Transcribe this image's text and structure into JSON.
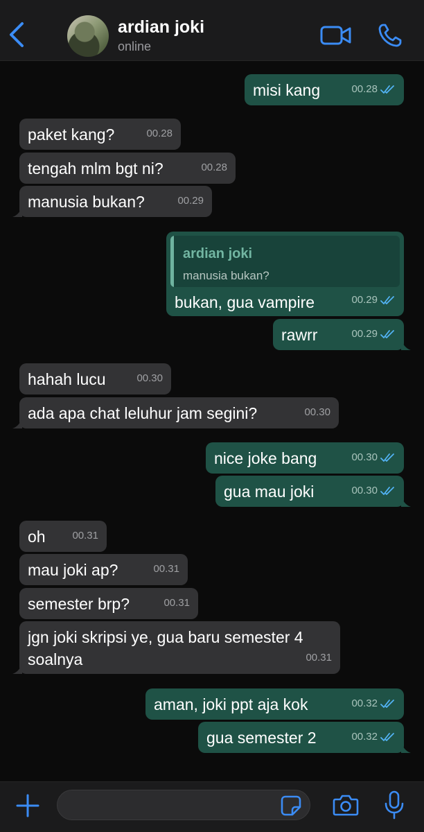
{
  "header": {
    "contact_name": "ardian joki",
    "status": "online"
  },
  "icons": {
    "back": "chevron-left-icon",
    "video": "video-camera-icon",
    "call": "phone-icon",
    "plus": "plus-icon",
    "sticker": "sticker-icon",
    "camera": "camera-icon",
    "mic": "microphone-icon",
    "read_receipt": "double-check-icon"
  },
  "colors": {
    "accent_blue": "#3b8cf5",
    "outgoing_bubble": "#1f5246",
    "incoming_bubble": "#333335",
    "read_tick": "#53b3f5"
  },
  "messages": [
    {
      "dir": "out",
      "text": "misi kang",
      "time": "00.28"
    },
    {
      "dir": "in",
      "text": "paket kang?",
      "time": "00.28"
    },
    {
      "dir": "in",
      "text": "tengah mlm bgt ni?",
      "time": "00.28"
    },
    {
      "dir": "in",
      "text": "manusia bukan?",
      "time": "00.29"
    },
    {
      "dir": "out",
      "text": "bukan, gua vampire",
      "time": "00.29",
      "reply": {
        "name": "ardian joki",
        "text": "manusia bukan?"
      }
    },
    {
      "dir": "out",
      "text": "rawrr",
      "time": "00.29"
    },
    {
      "dir": "in",
      "text": "hahah lucu",
      "time": "00.30"
    },
    {
      "dir": "in",
      "text": "ada apa chat leluhur jam segini?",
      "time": "00.30"
    },
    {
      "dir": "out",
      "text": "nice joke bang",
      "time": "00.30"
    },
    {
      "dir": "out",
      "text": "gua mau joki",
      "time": "00.30"
    },
    {
      "dir": "in",
      "text": "oh",
      "time": "00.31"
    },
    {
      "dir": "in",
      "text": "mau joki ap?",
      "time": "00.31"
    },
    {
      "dir": "in",
      "text": "semester brp?",
      "time": "00.31"
    },
    {
      "dir": "in",
      "text_line1": "jgn joki skripsi ye, gua baru semester 4",
      "text_line2": "soalnya",
      "time": "00.31"
    },
    {
      "dir": "out",
      "text": "aman, joki ppt aja kok",
      "time": "00.32"
    },
    {
      "dir": "out",
      "text": "gua semester 2",
      "time": "00.32"
    }
  ],
  "composer": {
    "value": "",
    "placeholder": ""
  }
}
